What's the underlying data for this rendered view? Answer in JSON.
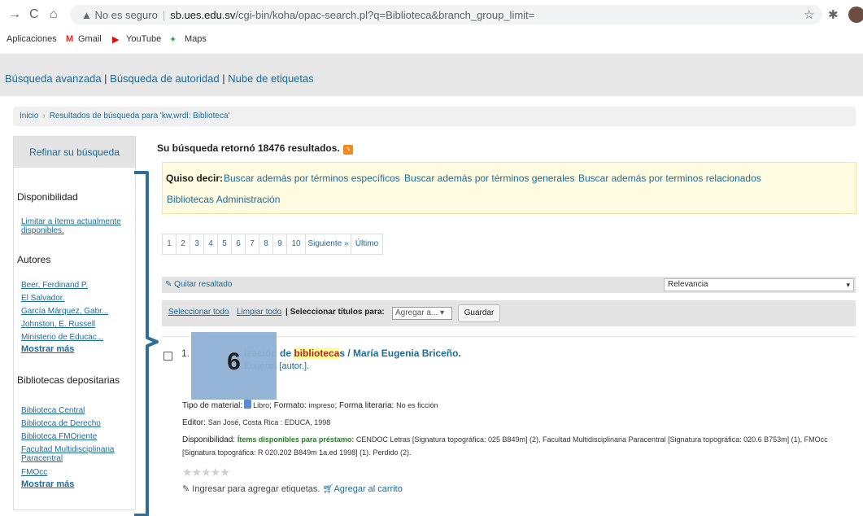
{
  "browser": {
    "security": "No es seguro",
    "url_host": "sb.ues.edu.sv",
    "url_path": "/cgi-bin/koha/opac-search.pl?q=Biblioteca&branch_group_limit=",
    "bookmarks": [
      "Aplicaciones",
      "Gmail",
      "YouTube",
      "Maps"
    ]
  },
  "top_nav": {
    "advanced": "Búsqueda avanzada",
    "authority": "Búsqueda de autoridad",
    "tags": "Nube de etiquetas",
    "sep": " | "
  },
  "breadcrumb": {
    "home": "Inicio",
    "current": "Resultados de búsqueda para 'kw,wrdl: Biblioteca'"
  },
  "sidebar": {
    "refine": "Refinar su búsqueda",
    "availability_head": "Disponibilidad",
    "availability_link_1": "Limitar a ítems actualmente",
    "availability_link_2": "disponibles.",
    "authors_head": "Autores",
    "authors": [
      "Beer, Ferdinand P.",
      "El Salvador.",
      "García Márquez, Gabr...",
      "Johnston, E. Russell",
      "Ministerio de Educac..."
    ],
    "more": "Mostrar más",
    "libraries_head": "Bibliotecas depositarias",
    "libraries": [
      "Biblioteca Central",
      "Biblioteca de Derecho",
      "Biblioteca FMOriente",
      "Facultad Multidisciplinaria",
      "Paracentral",
      "FMOcc"
    ]
  },
  "results": {
    "count_text": "Su búsqueda retornó 18476 resultados.",
    "did_you_mean": "Quiso decir:",
    "suggestions": [
      "Buscar además por términos específicos",
      "Buscar además por términos generales",
      "Buscar además por terminos relacionados",
      "Bibliotecas Administración"
    ],
    "pages": [
      "1",
      "2",
      "3",
      "4",
      "5",
      "6",
      "7",
      "8",
      "9",
      "10",
      "Siguiente »",
      "Último"
    ],
    "remove_highlight": "Quitar resaltado",
    "sort_value": "Relevancia",
    "select_all": "Seleccionar todo",
    "clear_all": "Limpiar todo",
    "select_titles_for": "| Seleccionar títulos para:",
    "add_to_value": "Agregar a...",
    "save": "Guardar"
  },
  "record": {
    "number": "1.",
    "title_pre": "ización de ",
    "title_hl": "biblioteca",
    "title_post": "s / María Eugenia Briceño.",
    "author": "Eugenia [autor.].",
    "material_label": "Tipo de material:",
    "material": "Libro",
    "format_label": "; Formato:",
    "format": "impreso",
    "literary_label": "; Forma literaria:",
    "literary": "No es ficción",
    "publisher_label": "Editor:",
    "publisher": "San José, Costa Rica : EDUCA, 1998",
    "availability_label": "Disponibilidad:",
    "availability_bold": "Ítems disponibles para préstamo:",
    "availability_1": "CENDOC Letras [Signatura topográfica: 025 B849m] (2), Facultad Multidisciplinaria Paracentral [Signatura topográfica: 020.6 B753m] (1), FMOcc",
    "availability_2": "[Signatura topográfica: R 020.202 B849m 1a.ed 1998] (1).",
    "lost": "Perdido (2).",
    "stars": "★★★★★",
    "tag_text": "Ingresar para agregar etiquetas.",
    "cart_text": "Agregar al carrito"
  },
  "overlay": {
    "number": "6",
    "color": "#8fb0d3",
    "bracket_color": "#2f6f9a"
  }
}
